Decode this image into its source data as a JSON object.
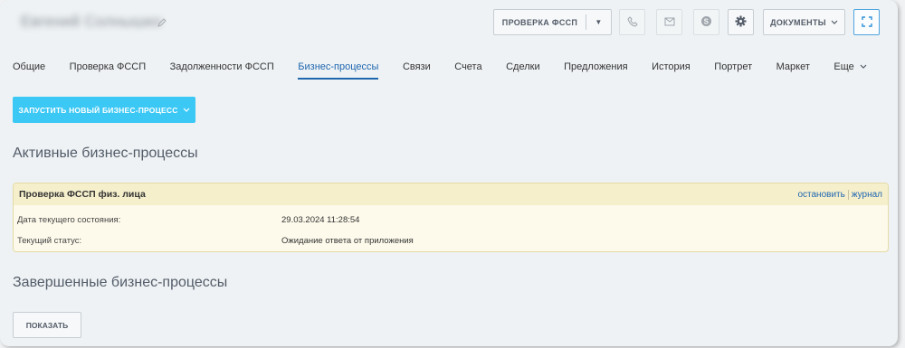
{
  "header": {
    "title": "Евгений Солнышко",
    "check_button_label": "ПРОВЕРКА ФССП",
    "documents_button_label": "ДОКУМЕНТЫ"
  },
  "tabs": [
    {
      "label": "Общие"
    },
    {
      "label": "Проверка ФССП"
    },
    {
      "label": "Задолженности ФССП"
    },
    {
      "label": "Бизнес-процессы",
      "active": true
    },
    {
      "label": "Связи"
    },
    {
      "label": "Счета"
    },
    {
      "label": "Сделки"
    },
    {
      "label": "Предложения"
    },
    {
      "label": "История"
    },
    {
      "label": "Портрет"
    },
    {
      "label": "Маркет"
    },
    {
      "label": "Еще"
    }
  ],
  "run_button_label": "ЗАПУСТИТЬ НОВЫЙ БИЗНЕС-ПРОЦЕСС",
  "active_section_title": "Активные бизнес-процессы",
  "process": {
    "title": "Проверка ФССП физ. лица",
    "stop_label": "остановить",
    "log_label": "журнал",
    "date_label": "Дата текущего состояния:",
    "date_value": "29.03.2024 11:28:54",
    "status_label": "Текущий статус:",
    "status_value": "Ожидание ответа от приложения"
  },
  "completed_section_title": "Завершенные бизнес-процессы",
  "show_button_label": "ПОКАЗАТЬ",
  "colors": {
    "accent": "#2067b0",
    "run_button": "#3bc8f5",
    "panel_header": "#f5efcc",
    "panel_body": "#fdfaeb"
  }
}
